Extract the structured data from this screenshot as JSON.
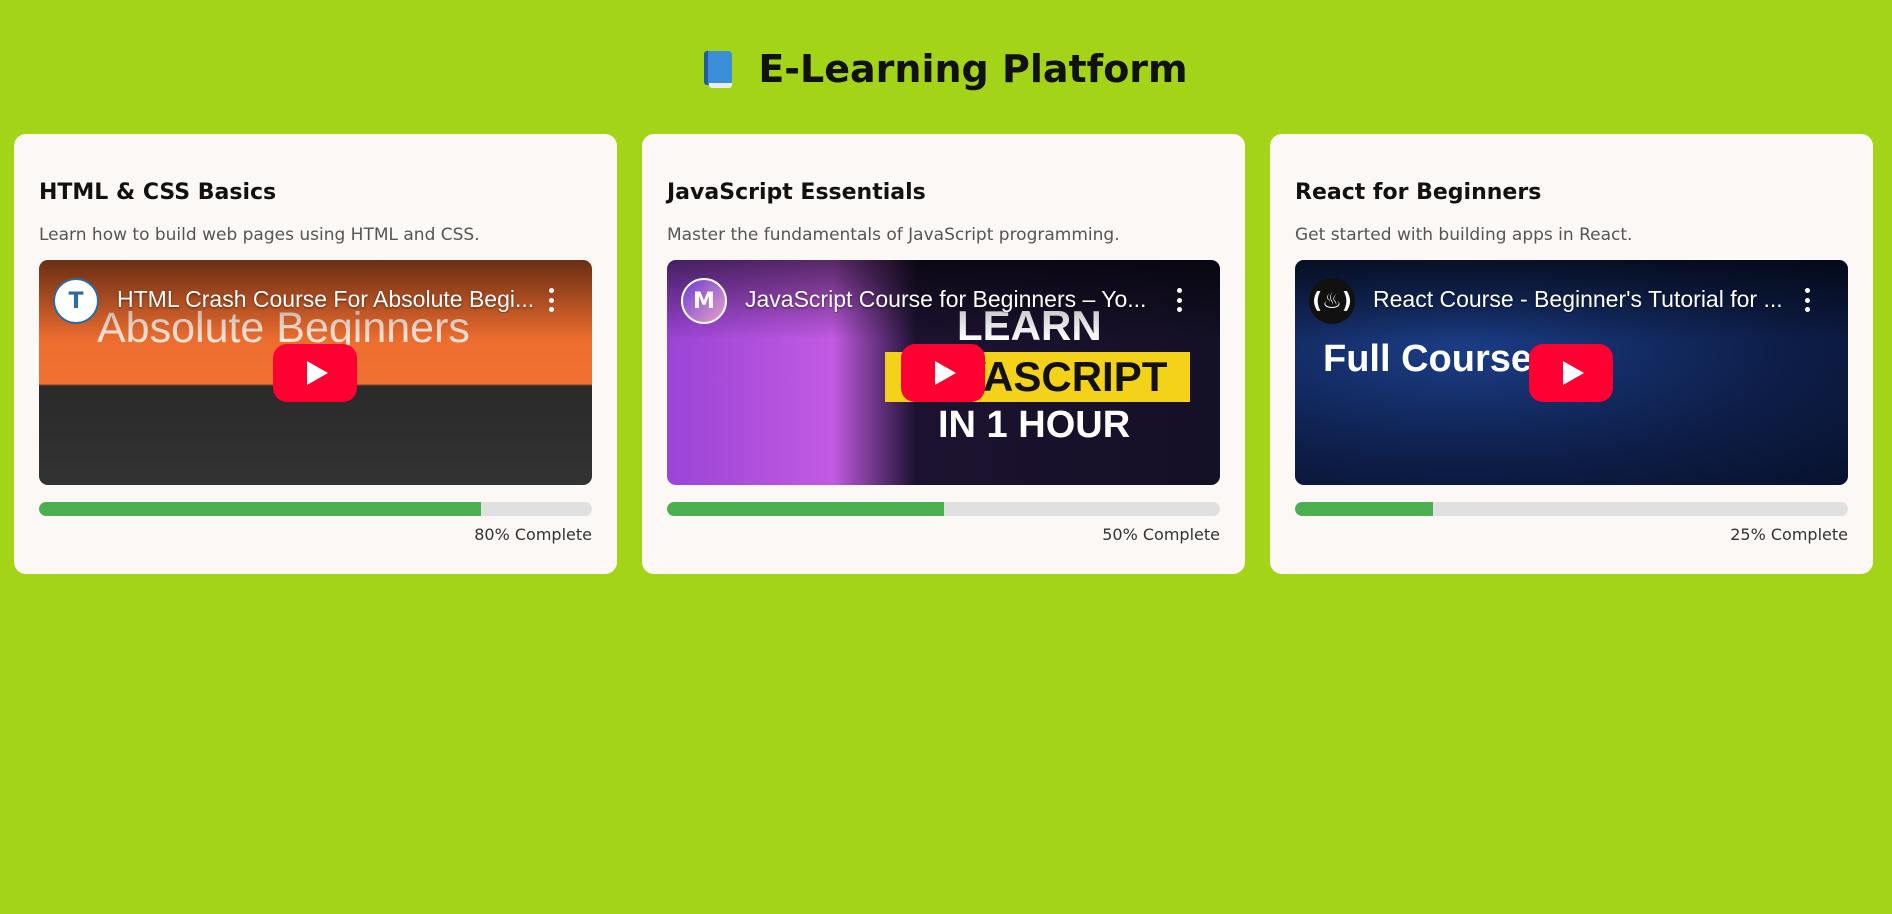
{
  "header": {
    "title": "E-Learning Platform",
    "icon": "book-icon"
  },
  "colors": {
    "background": "#a4d418",
    "card": "#fcf8f6",
    "progress_fill": "#4caf50",
    "progress_track": "#e0e0e0",
    "play_button": "#ff0033"
  },
  "courses": [
    {
      "title": "HTML & CSS Basics",
      "description": "Learn how to build web pages using HTML and CSS.",
      "video": {
        "title": "HTML Crash Course For Absolute Begi...",
        "channel_avatar": "T",
        "thumbnail_text": [
          "Absolute Beginners"
        ]
      },
      "progress": 0.8,
      "progress_label": "80% Complete"
    },
    {
      "title": "JavaScript Essentials",
      "description": "Master the fundamentals of JavaScript programming.",
      "video": {
        "title": "JavaScript Course for Beginners – Yo...",
        "channel_avatar": "M",
        "thumbnail_text": [
          "LEARN",
          "JAVASCRIPT",
          "IN 1 HOUR"
        ]
      },
      "progress": 0.5,
      "progress_label": "50% Complete"
    },
    {
      "title": "React for Beginners",
      "description": "Get started with building apps in React.",
      "video": {
        "title": "React Course - Beginner's Tutorial for ...",
        "channel_avatar": "(♨)",
        "thumbnail_text": [
          "Full Course"
        ]
      },
      "progress": 0.25,
      "progress_label": "25% Complete"
    }
  ]
}
